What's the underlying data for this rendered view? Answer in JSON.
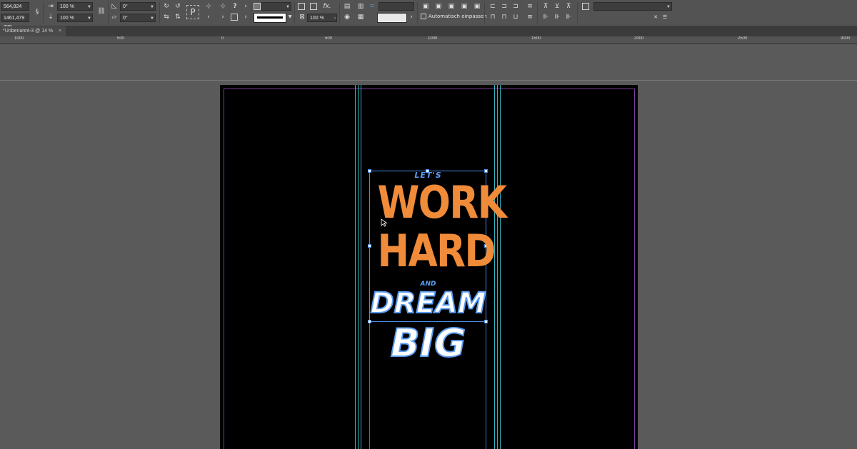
{
  "control_bar": {
    "x_value": "564,824 mm",
    "y_value": "1461,479 mm",
    "scale_x": "100 %",
    "scale_y": "100 %",
    "rotation": "0°",
    "shear": "0°",
    "stroke_weight": "",
    "opacity": "100 %",
    "auto_fit_label": "Automatisch einpassen",
    "style_dropdown": ""
  },
  "document_tab": {
    "title": "*Unbenannt-3 @ 14 %",
    "close": "×"
  },
  "ruler": {
    "labels": [
      "1000",
      "500",
      "0",
      "500",
      "1000",
      "1500",
      "2000",
      "2500",
      "3000"
    ]
  },
  "artwork": {
    "line1": "LET'S",
    "line2": "WORK",
    "line3": "HARD",
    "line4": "AND",
    "line5": "DREAM",
    "line6": "BIG"
  },
  "colors": {
    "accent_orange": "#f08b3a",
    "accent_blue": "#5b9cf0",
    "guide_cyan": "#2fb6c0",
    "margin_purple": "#7a3e9e",
    "selection": "#4a8de8"
  }
}
